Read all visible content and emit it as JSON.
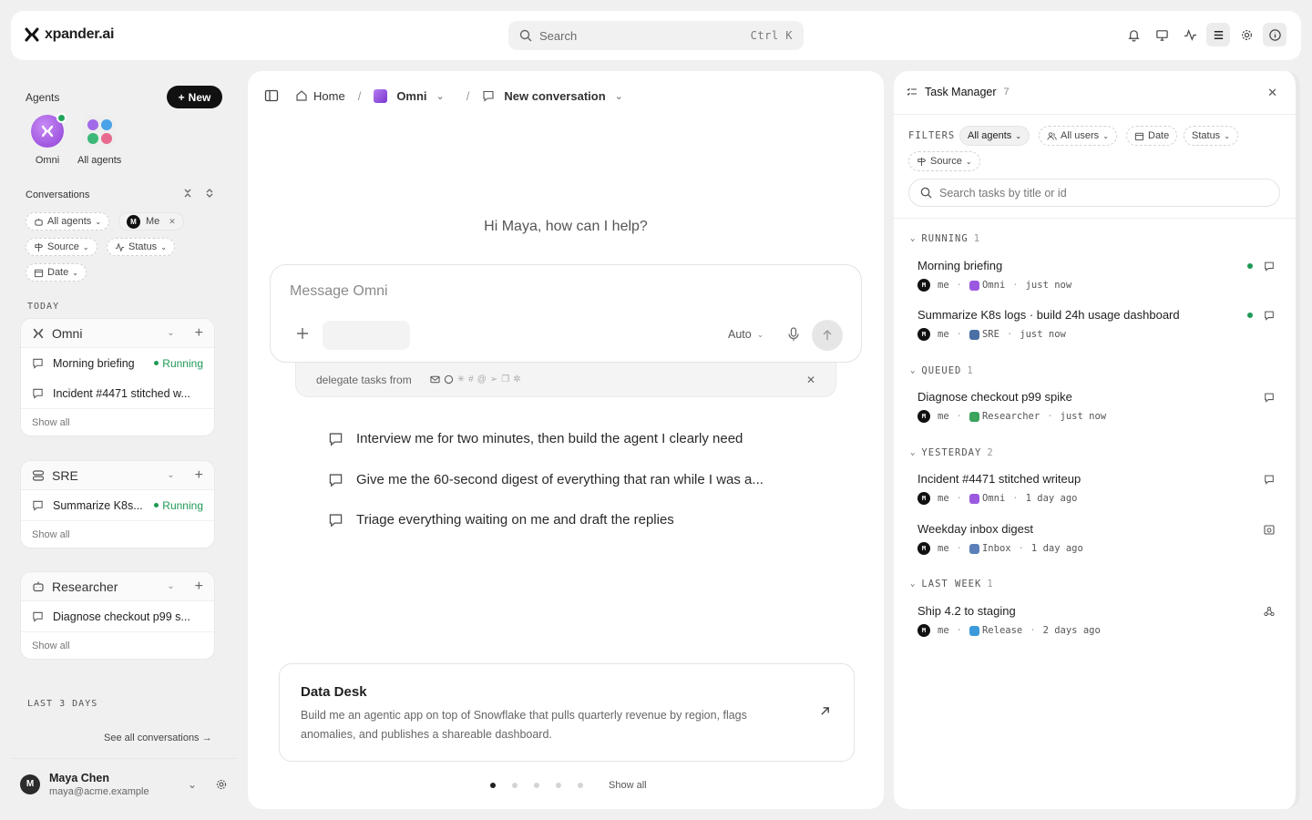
{
  "app": {
    "logo_text": "xpander.ai"
  },
  "search": {
    "placeholder": "Search",
    "shortcut": "Ctrl K"
  },
  "top_icons": [
    "bell-icon",
    "monitor-icon",
    "activity-icon",
    "list-icon",
    "gear-icon",
    "info-icon"
  ],
  "sidebar": {
    "agents_label": "Agents",
    "new_label": "New",
    "agents": [
      {
        "label": "Omni"
      },
      {
        "label": "All agents"
      }
    ],
    "conversations_label": "Conversations",
    "filters": {
      "all_agents": "All agents",
      "me": "Me",
      "me_initial": "M",
      "source": "Source",
      "status": "Status",
      "date": "Date"
    },
    "today_label": "TODAY",
    "groups": [
      {
        "name": "Omni",
        "items": [
          {
            "title": "Morning briefing",
            "status": "Running"
          },
          {
            "title": "Incident #4471 stitched w...",
            "status": ""
          }
        ],
        "show_all": "Show all"
      },
      {
        "name": "SRE",
        "items": [
          {
            "title": "Summarize K8s...",
            "status": "Running"
          }
        ],
        "show_all": "Show all"
      },
      {
        "name": "Researcher",
        "items": [
          {
            "title": "Diagnose checkout p99 s...",
            "status": ""
          }
        ],
        "show_all": "Show all"
      }
    ],
    "last3_label": "LAST 3 DAYS",
    "see_all": "See all conversations →",
    "user": {
      "initial": "M",
      "name": "Maya Chen",
      "email": "maya@acme.example"
    }
  },
  "main": {
    "breadcrumb": {
      "home": "Home",
      "agent": "Omni",
      "conversation": "New conversation"
    },
    "greeting": "Hi Maya, how can I help?",
    "composer": {
      "placeholder": "Message Omni",
      "model": "Auto"
    },
    "delegate": {
      "text": "delegate tasks from"
    },
    "suggestions": [
      "Interview me for two minutes, then build the agent I clearly need",
      "Give me the 60-second digest of everything that ran while I was a...",
      "Triage everything waiting on me and draft the replies"
    ],
    "card": {
      "title": "Data Desk",
      "description": "Build me an agentic app on top of Snowflake that pulls quarterly revenue by region, flags anomalies, and publishes a shareable dashboard."
    },
    "pager": {
      "current": 1,
      "total": 5,
      "show_all": "Show all"
    }
  },
  "task_manager": {
    "title": "Task Manager",
    "count": "7",
    "filters_label": "FILTERS",
    "filters": {
      "all_agents": "All agents",
      "all_users": "All users",
      "date": "Date",
      "status": "Status",
      "source": "Source"
    },
    "search_placeholder": "Search tasks by title or id",
    "groups": [
      {
        "label": "RUNNING",
        "count": "1"
      },
      {
        "label": "QUEUED",
        "count": "1"
      },
      {
        "label": "YESTERDAY",
        "count": "2"
      },
      {
        "label": "LAST WEEK",
        "count": "1"
      }
    ],
    "tasks": [
      {
        "title": "Morning briefing",
        "user": "me",
        "user_initial": "M",
        "agent": "Omni",
        "agent_color": "#9b59e0",
        "time": "just now",
        "running": true,
        "icon": "chat-icon"
      },
      {
        "title": "Summarize K8s logs · build 24h usage dashboard",
        "user": "me",
        "user_initial": "M",
        "agent": "SRE",
        "agent_color": "#4a6fa5",
        "time": "just now",
        "running": true,
        "icon": "chat-icon"
      },
      {
        "title": "Diagnose checkout p99 spike",
        "user": "me",
        "user_initial": "M",
        "agent": "Researcher",
        "agent_color": "#3aa35c",
        "time": "just now",
        "running": false,
        "icon": "chat-icon"
      },
      {
        "title": "Incident #4471 stitched writeup",
        "user": "me",
        "user_initial": "M",
        "agent": "Omni",
        "agent_color": "#9b59e0",
        "time": "1 day ago",
        "running": false,
        "icon": "chat-icon"
      },
      {
        "title": "Weekday inbox digest",
        "user": "me",
        "user_initial": "M",
        "agent": "Inbox",
        "agent_color": "#5b7fb8",
        "time": "1 day ago",
        "running": false,
        "icon": "calendar-clock-icon"
      },
      {
        "title": "Ship 4.2 to staging",
        "user": "me",
        "user_initial": "M",
        "agent": "Release",
        "agent_color": "#3b9ad9",
        "time": "2 days ago",
        "running": false,
        "icon": "webhook-icon"
      }
    ]
  }
}
